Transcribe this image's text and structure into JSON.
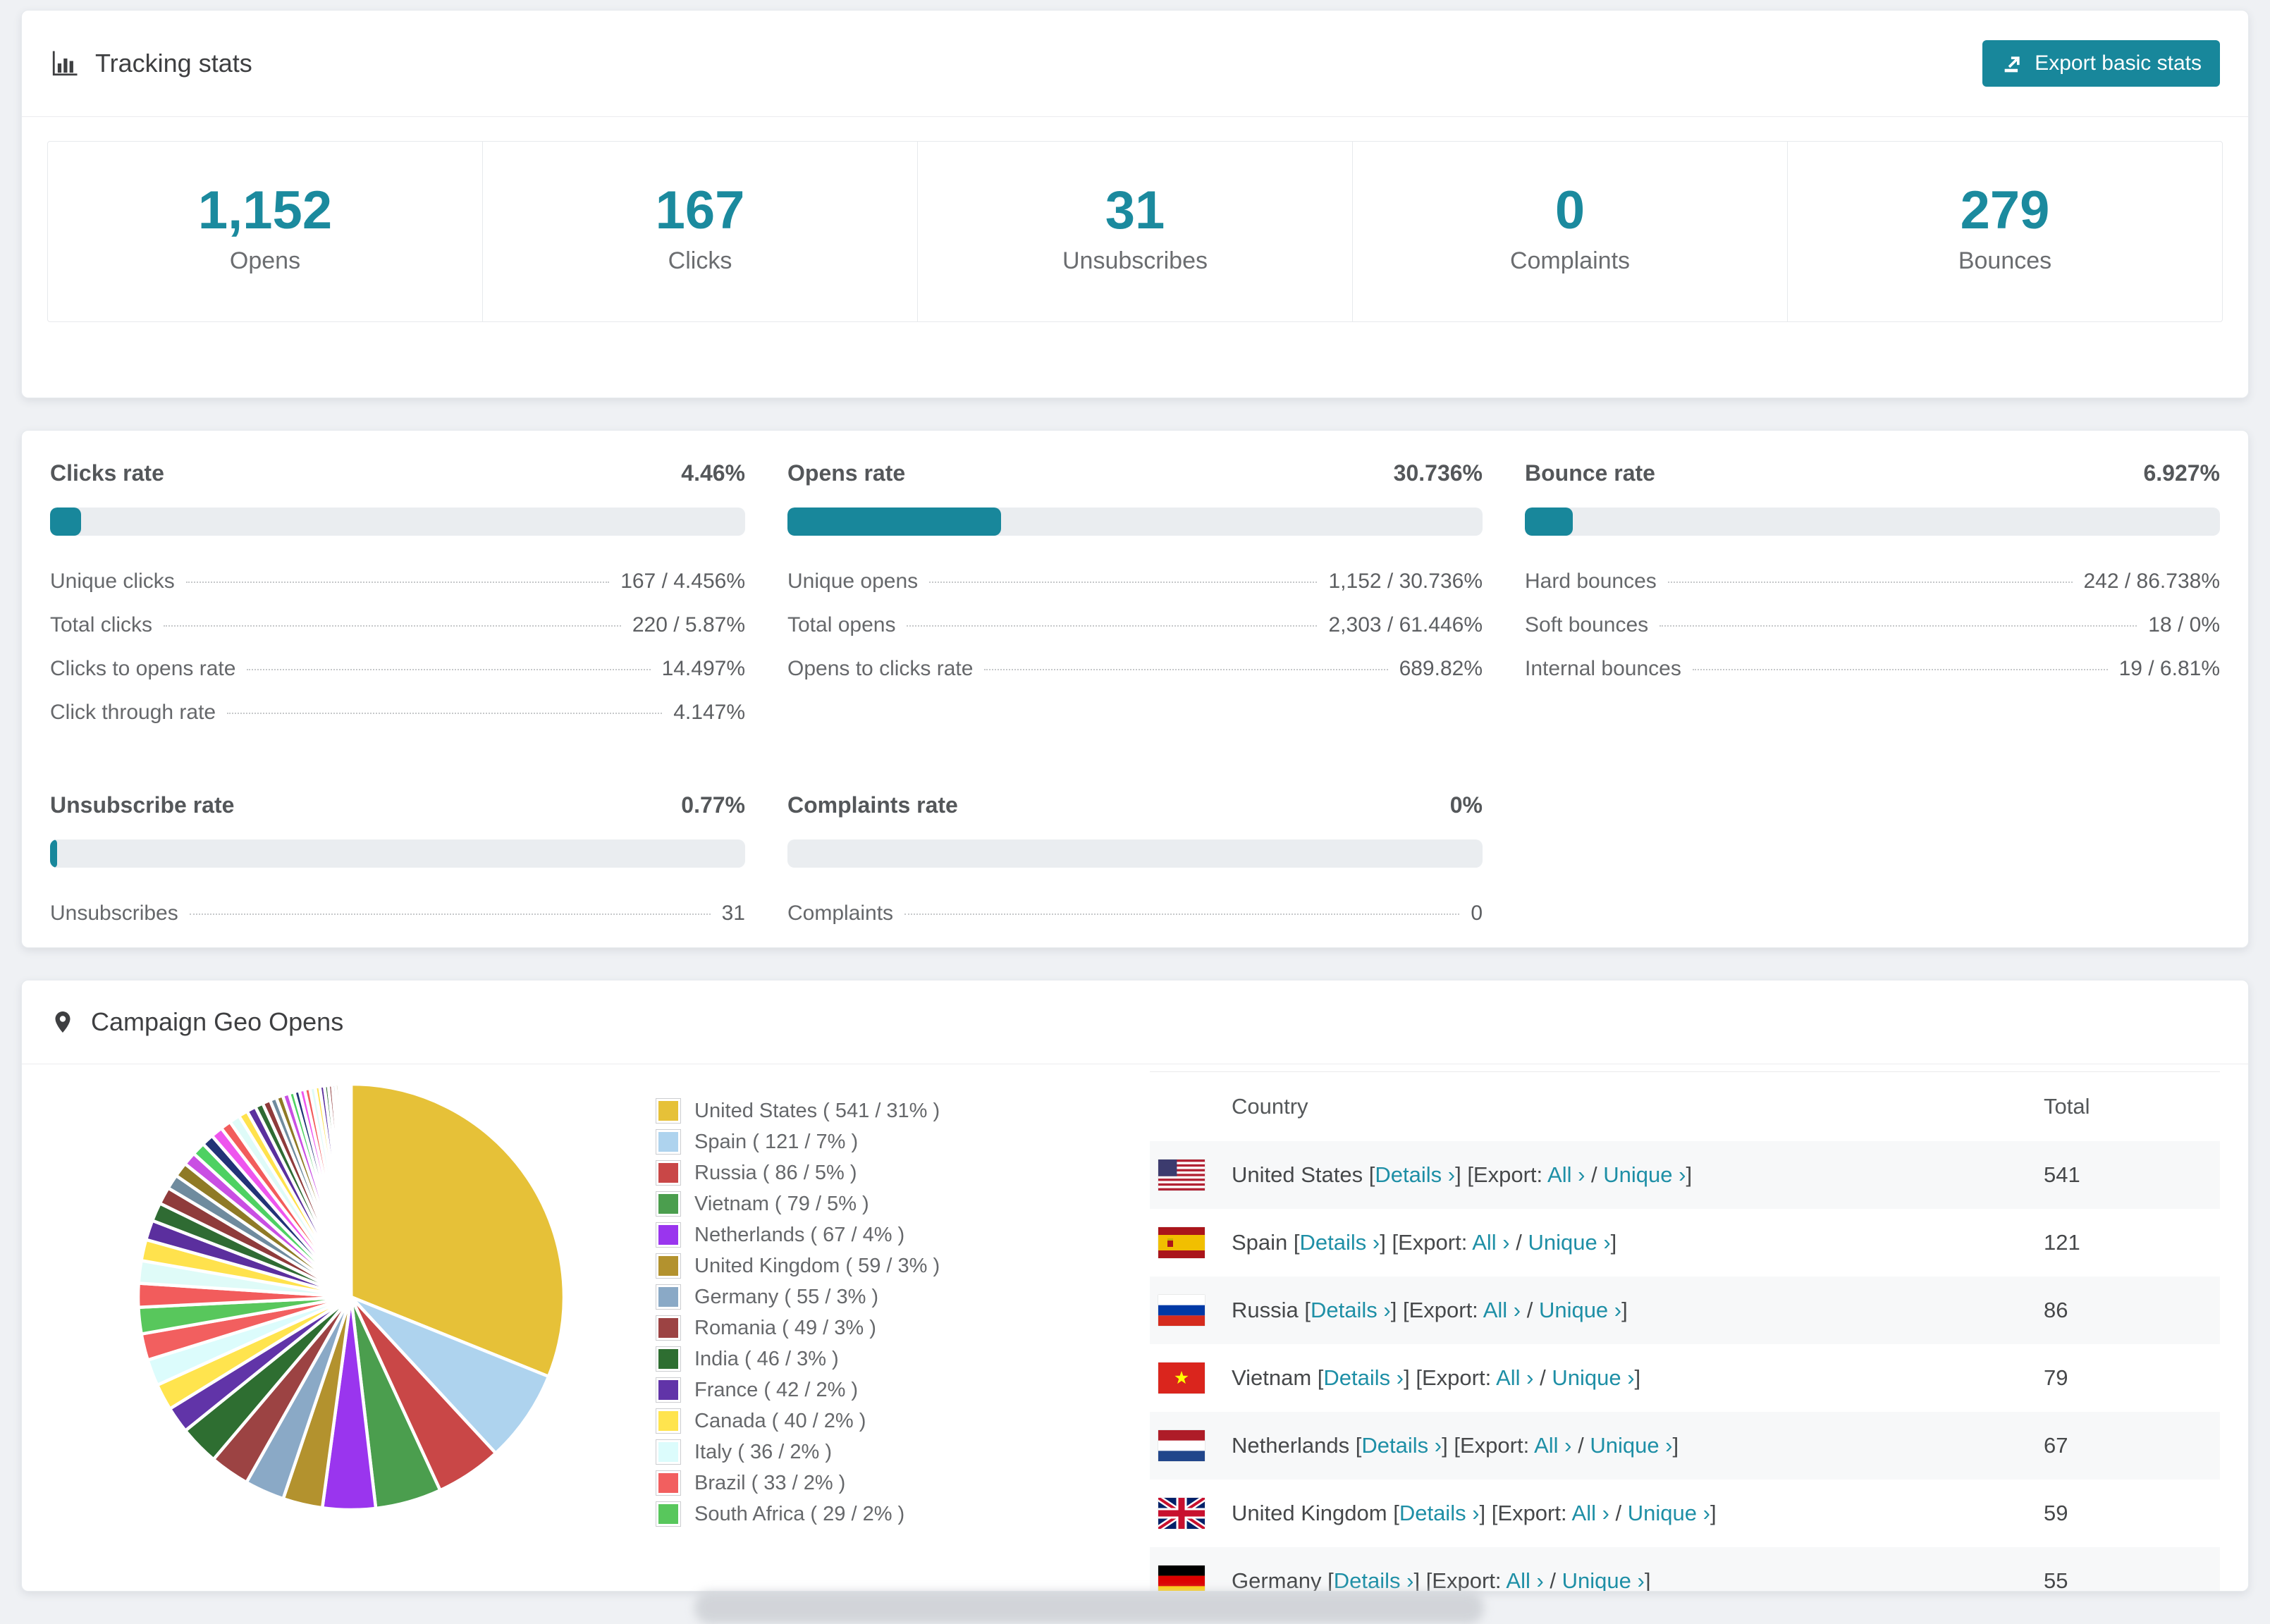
{
  "accent": "#18879b",
  "tracking": {
    "title": "Tracking stats",
    "export_button": "Export basic stats",
    "summary": [
      {
        "value": "1,152",
        "label": "Opens"
      },
      {
        "value": "167",
        "label": "Clicks"
      },
      {
        "value": "31",
        "label": "Unsubscribes"
      },
      {
        "value": "0",
        "label": "Complaints"
      },
      {
        "value": "279",
        "label": "Bounces"
      }
    ]
  },
  "rates": [
    {
      "id": "clicks",
      "title": "Clicks rate",
      "value": "4.46%",
      "pct": 4.46,
      "rows": [
        {
          "label": "Unique clicks",
          "value": "167 / 4.456%"
        },
        {
          "label": "Total clicks",
          "value": "220 / 5.87%"
        },
        {
          "label": "Clicks to opens rate",
          "value": "14.497%"
        },
        {
          "label": "Click through rate",
          "value": "4.147%"
        }
      ]
    },
    {
      "id": "opens",
      "title": "Opens rate",
      "value": "30.736%",
      "pct": 30.736,
      "rows": [
        {
          "label": "Unique opens",
          "value": "1,152 / 30.736%"
        },
        {
          "label": "Total opens",
          "value": "2,303 / 61.446%"
        },
        {
          "label": "Opens to clicks rate",
          "value": "689.82%"
        }
      ]
    },
    {
      "id": "bounce",
      "title": "Bounce rate",
      "value": "6.927%",
      "pct": 6.927,
      "rows": [
        {
          "label": "Hard bounces",
          "value": "242 / 86.738%"
        },
        {
          "label": "Soft bounces",
          "value": "18 / 0%"
        },
        {
          "label": "Internal bounces",
          "value": "19 / 6.81%"
        }
      ]
    },
    {
      "id": "unsubscribe",
      "title": "Unsubscribe rate",
      "value": "0.77%",
      "pct": 0.77,
      "rows": [
        {
          "label": "Unsubscribes",
          "value": "31"
        }
      ]
    },
    {
      "id": "complaints",
      "title": "Complaints rate",
      "value": "0%",
      "pct": 0,
      "rows": [
        {
          "label": "Complaints",
          "value": "0"
        }
      ]
    }
  ],
  "geo": {
    "title": "Campaign Geo Opens",
    "legend": [
      {
        "label": "United States ( 541 / 31% )",
        "color": "#e6c138"
      },
      {
        "label": "Spain ( 121 / 7% )",
        "color": "#aed3ee"
      },
      {
        "label": "Russia ( 86 / 5% )",
        "color": "#c94747"
      },
      {
        "label": "Vietnam ( 79 / 5% )",
        "color": "#4b9e4e"
      },
      {
        "label": "Netherlands ( 67 / 4% )",
        "color": "#9a35ee"
      },
      {
        "label": "United Kingdom ( 59 / 3% )",
        "color": "#b3922e"
      },
      {
        "label": "Germany ( 55 / 3% )",
        "color": "#8aa9c6"
      },
      {
        "label": "Romania ( 49 / 3% )",
        "color": "#9c4343"
      },
      {
        "label": "India ( 46 / 3% )",
        "color": "#2e6e31"
      },
      {
        "label": "France ( 42 / 2% )",
        "color": "#6134a8"
      },
      {
        "label": "Canada ( 40 / 2% )",
        "color": "#ffe44e"
      },
      {
        "label": "Italy ( 36 / 2% )",
        "color": "#dcfcfc"
      },
      {
        "label": "Brazil ( 33 / 2% )",
        "color": "#f25f5f"
      },
      {
        "label": "South Africa ( 29 / 2% )",
        "color": "#58c75c"
      }
    ],
    "table": {
      "columns": [
        "Country",
        "Total"
      ],
      "details_label": "Details",
      "export_label": "Export:",
      "all_label": "All",
      "unique_label": "Unique",
      "chevron": "›",
      "bracket_open": "[",
      "bracket_close": "]",
      "separator": "/",
      "rows": [
        {
          "country": "United States",
          "flag": "us",
          "total": "541"
        },
        {
          "country": "Spain",
          "flag": "es",
          "total": "121"
        },
        {
          "country": "Russia",
          "flag": "ru",
          "total": "86"
        },
        {
          "country": "Vietnam",
          "flag": "vn",
          "total": "79"
        },
        {
          "country": "Netherlands",
          "flag": "nl",
          "total": "67"
        },
        {
          "country": "United Kingdom",
          "flag": "gb",
          "total": "59"
        },
        {
          "country": "Germany",
          "flag": "de",
          "total": "55"
        }
      ]
    },
    "chart_data": {
      "type": "pie",
      "title": "Campaign Geo Opens",
      "labels": [
        "United States",
        "Spain",
        "Russia",
        "Vietnam",
        "Netherlands",
        "United Kingdom",
        "Germany",
        "Romania",
        "India",
        "France",
        "Canada",
        "Italy",
        "Brazil",
        "South Africa"
      ],
      "values": [
        541,
        121,
        86,
        79,
        67,
        59,
        55,
        49,
        46,
        42,
        40,
        36,
        33,
        29
      ],
      "percents": [
        31,
        7,
        5,
        5,
        4,
        3,
        3,
        3,
        3,
        2,
        2,
        2,
        2,
        2
      ],
      "colors": [
        "#e6c138",
        "#aed3ee",
        "#c94747",
        "#4b9e4e",
        "#9a35ee",
        "#b3922e",
        "#8aa9c6",
        "#9c4343",
        "#2e6e31",
        "#6134a8",
        "#ffe44e",
        "#dcfcfc",
        "#f25f5f",
        "#58c75c"
      ],
      "others_percents": [
        1.8,
        1.7,
        1.6,
        1.5,
        1.4,
        1.3,
        1.1,
        1.1,
        1.0,
        1.0,
        0.9,
        0.9,
        0.8,
        0.8,
        0.7,
        0.7,
        0.6,
        0.6,
        0.5,
        0.5,
        0.5,
        0.4,
        0.4,
        0.4,
        0.4,
        0.4,
        0.35,
        0.35,
        0.3,
        0.3,
        0.25,
        0.25,
        0.2,
        0.2,
        0.15,
        0.15,
        0.1,
        0.1
      ],
      "others_color_cycle": [
        "#f25c5c",
        "#dffbf8",
        "#ffe24d",
        "#5b2f9e",
        "#2f6b33",
        "#8f3b3b",
        "#6f8b9e",
        "#8f7a26",
        "#c94fe3",
        "#4ed162",
        "#223377",
        "#ee55ee"
      ],
      "start_angle_deg": 0,
      "direction": "clockwise",
      "legend_position": "right"
    }
  }
}
